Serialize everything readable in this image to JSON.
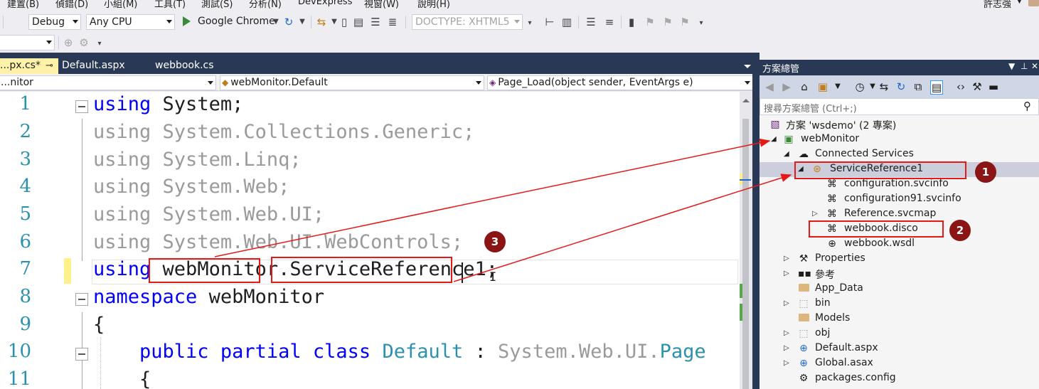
{
  "menu": {
    "items": [
      "建置(B)",
      "偵錯(D)",
      "小組(M)",
      "工具(T)",
      "測試(S)",
      "分析(N)",
      "DevExpress",
      "視窗(W)",
      "說明(H)"
    ],
    "user": "許志強"
  },
  "toolbar": {
    "config": "Debug",
    "platform": "Any CPU",
    "browser": "Google Chrome",
    "doctype": "DOCTYPE: XHTML5"
  },
  "tabs": {
    "active": "...px.cs*",
    "t2": "Default.aspx",
    "t3": "webbook.cs"
  },
  "nav": {
    "project": "...nitor",
    "class": "webMonitor.Default",
    "member": "Page_Load(object sender, EventArgs e)"
  },
  "code": {
    "line_numbers": [
      "1",
      "2",
      "3",
      "4",
      "5",
      "6",
      "7",
      "8",
      "9",
      "10",
      "11"
    ],
    "using": "using",
    "system": "System;",
    "l2": "System.Collections.Generic;",
    "l3": "System.Linq;",
    "l4": "System.Web;",
    "l5": "System.Web.UI;",
    "l6": "System.Web.UI.WebControls;",
    "l7_ns": "webMonitor",
    "l7_dot": ".",
    "l7_ref": "ServiceReference1",
    "l7_semi": ";",
    "namespace_kw": "namespace",
    "namespace_name": "webMonitor",
    "brace_open": "{",
    "public_kw": "public",
    "partial_kw": "partial",
    "class_kw": "class",
    "class_name": "Default",
    "colon": ":",
    "base_prefix": "System.Web.UI.",
    "base_type": "Page",
    "brace_open2": "{"
  },
  "solution_explorer": {
    "title": "方案總管",
    "search_placeholder": "搜尋方案總管 (Ctrl+;)",
    "nodes": {
      "solution": "方案 'wsdemo' (2 專案)",
      "project": "webMonitor",
      "connected": "Connected Services",
      "svcref": "ServiceReference1",
      "cfg": "configuration.svcinfo",
      "cfg91": "configuration91.svcinfo",
      "reference": "Reference.svcmap",
      "disco": "webbook.disco",
      "wsdl": "webbook.wsdl",
      "properties": "Properties",
      "refs": "參考",
      "appdata": "App_Data",
      "bin": "bin",
      "models": "Models",
      "obj": "obj",
      "default_aspx": "Default.aspx",
      "global_asax": "Global.asax",
      "packages": "packages.config"
    }
  },
  "callouts": {
    "b1": "1",
    "b2": "2",
    "b3": "3"
  },
  "colors": {
    "annotation_red": "#e61818",
    "badge": "#8b1414",
    "tab_bg": "#293955",
    "keyword": "#0000ff",
    "type": "#2b91af"
  }
}
